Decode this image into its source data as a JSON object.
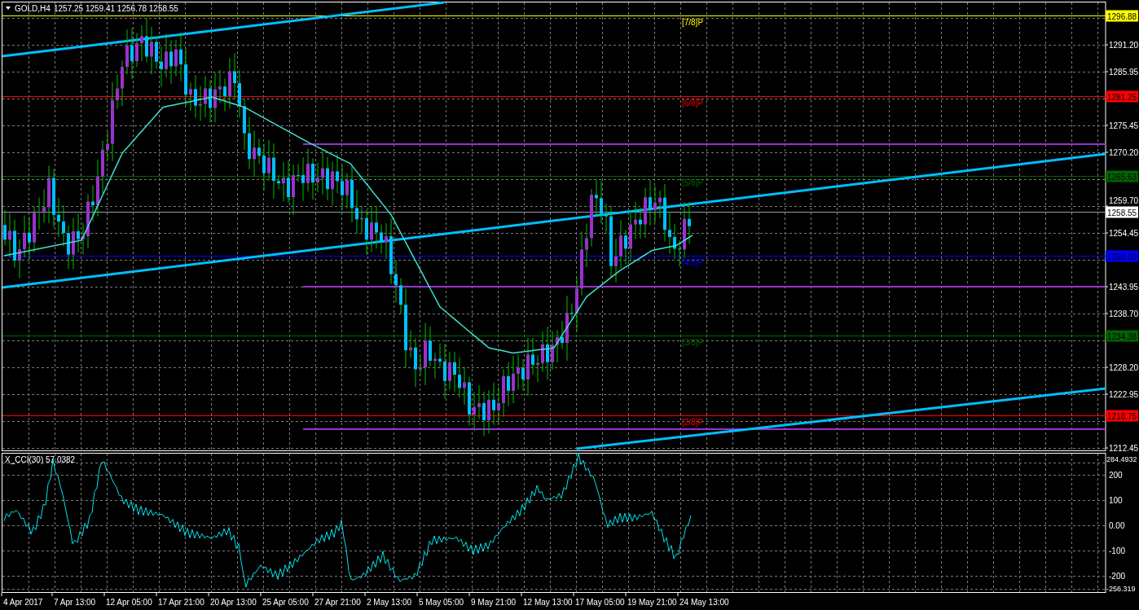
{
  "header": {
    "symbol": "GOLD,H4",
    "quote": "1257.25 1259.41 1256.78 1258.55"
  },
  "price_axis": [
    "1291.20",
    "1285.95",
    "1275.45",
    "1270.20",
    "1259.70",
    "1254.45",
    "1243.95",
    "1238.70",
    "1228.20",
    "1222.95",
    "1212.45"
  ],
  "levels": [
    {
      "price": "1296.88",
      "label": "[7/8]P",
      "color": "#ffff00"
    },
    {
      "price": "1281.25",
      "label": "[6/8]P",
      "color": "#ff0000"
    },
    {
      "price": "1265.63",
      "label": "[5/8]P",
      "color": "#006400"
    },
    {
      "price": "1250.00",
      "label": "[4/8]P",
      "color": "#0000ff"
    },
    {
      "price": "1234.38",
      "label": "[3/8]P",
      "color": "#006400"
    },
    {
      "price": "1218.75",
      "label": "[2/8]P",
      "color": "#ff0000"
    }
  ],
  "current_price": "1258.55",
  "indicator": {
    "label": "X_CCI(30) 57.0382",
    "scale": [
      "284.4932",
      "200",
      "100",
      "0.00",
      "-100",
      "-200",
      "-256.319"
    ]
  },
  "time_axis": [
    "4 Apr 2017",
    "7 Apr 13:00",
    "12 Apr 05:00",
    "17 Apr 21:00",
    "20 Apr 13:00",
    "25 Apr 05:00",
    "27 Apr 21:00",
    "2 May 13:00",
    "5 May 05:00",
    "9 May 21:00",
    "12 May 13:00",
    "17 May 05:00",
    "19 May 21:00",
    "24 May 13:00"
  ]
}
